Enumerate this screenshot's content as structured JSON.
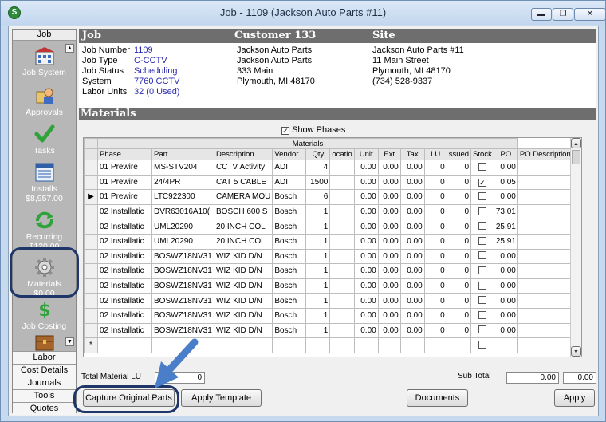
{
  "window": {
    "title": "Job - 1109 (Jackson Auto Parts #11)",
    "app_icon": "S",
    "controls": [
      "minimize",
      "restore",
      "close"
    ]
  },
  "sidebar": {
    "header": "Job",
    "items": [
      {
        "label": "Job System",
        "sub": "",
        "icon": "building-icon"
      },
      {
        "label": "Approvals",
        "sub": "",
        "icon": "approvals-icon"
      },
      {
        "label": "Tasks",
        "sub": "",
        "icon": "check-icon"
      },
      {
        "label": "Installs",
        "sub": "$8,957.00",
        "icon": "installs-icon"
      },
      {
        "label": "Recurring",
        "sub": "$120.00",
        "icon": "recurring-icon"
      },
      {
        "label": "Materials",
        "sub": "$0.00",
        "icon": "gear-icon"
      },
      {
        "label": "Job Costing",
        "sub": "",
        "icon": "dollar-icon"
      }
    ],
    "bottom": [
      "Labor",
      "Cost Details",
      "Journals",
      "Tools",
      "Quotes"
    ]
  },
  "headers": {
    "job": "Job",
    "customer": "Customer 133",
    "site": "Site"
  },
  "job": [
    {
      "label": "Job Number",
      "value": "1109"
    },
    {
      "label": "Job Type",
      "value": "C-CCTV"
    },
    {
      "label": "Job Status",
      "value": "Scheduling"
    },
    {
      "label": "System",
      "value": "7760 CCTV"
    },
    {
      "label": "Labor Units",
      "value": "32 (0 Used)"
    }
  ],
  "customer": [
    "Jackson Auto Parts",
    "Jackson Auto Parts",
    "333 Main",
    "Plymouth, MI  48170"
  ],
  "site": [
    "Jackson Auto Parts #11",
    "11 Main Street",
    "Plymouth, MI  48170",
    "(734) 528-9337"
  ],
  "materials_title": "Materials",
  "show_phases": {
    "label": "Show Phases",
    "checked": true
  },
  "grid": {
    "group_header": "Materials",
    "columns": [
      "Phase",
      "Part",
      "Description",
      "Vendor",
      "Qty",
      "ocatio",
      "Unit",
      "Ext",
      "Tax",
      "LU",
      "ssued",
      "Stock",
      "PO",
      "PO Description"
    ],
    "rows": [
      [
        "01 Prewire",
        "MS-STV204",
        "CCTV Activity",
        "ADI",
        "4",
        "",
        "0.00",
        "0.00",
        "0.00",
        "0",
        "0",
        "",
        "0.00",
        ""
      ],
      [
        "01 Prewire",
        "24/4PR",
        "CAT 5 CABLE",
        "ADI",
        "1500",
        "",
        "0.00",
        "0.00",
        "0.00",
        "0",
        "0",
        "checked",
        "0.05",
        ""
      ],
      [
        "01 Prewire",
        "LTC922300",
        "CAMERA MOU",
        "Bosch",
        "6",
        "",
        "0.00",
        "0.00",
        "0.00",
        "0",
        "0",
        "",
        "0.00",
        ""
      ],
      [
        "02 Installatic",
        "DVR63016A10(",
        "BOSCH 600 S",
        "Bosch",
        "1",
        "",
        "0.00",
        "0.00",
        "0.00",
        "0",
        "0",
        "",
        "73.01",
        ""
      ],
      [
        "02 Installatic",
        "UML20290",
        "20 INCH  COL",
        "Bosch",
        "1",
        "",
        "0.00",
        "0.00",
        "0.00",
        "0",
        "0",
        "",
        "25.91",
        ""
      ],
      [
        "02 Installatic",
        "UML20290",
        "20 INCH  COL",
        "Bosch",
        "1",
        "",
        "0.00",
        "0.00",
        "0.00",
        "0",
        "0",
        "",
        "25.91",
        ""
      ],
      [
        "02 Installatic",
        "BOSWZ18NV31",
        "WIZ KID D/N",
        "Bosch",
        "1",
        "",
        "0.00",
        "0.00",
        "0.00",
        "0",
        "0",
        "",
        "0.00",
        ""
      ],
      [
        "02 Installatic",
        "BOSWZ18NV31",
        "WIZ KID D/N",
        "Bosch",
        "1",
        "",
        "0.00",
        "0.00",
        "0.00",
        "0",
        "0",
        "",
        "0.00",
        ""
      ],
      [
        "02 Installatic",
        "BOSWZ18NV31",
        "WIZ KID D/N",
        "Bosch",
        "1",
        "",
        "0.00",
        "0.00",
        "0.00",
        "0",
        "0",
        "",
        "0.00",
        ""
      ],
      [
        "02 Installatic",
        "BOSWZ18NV31",
        "WIZ KID D/N",
        "Bosch",
        "1",
        "",
        "0.00",
        "0.00",
        "0.00",
        "0",
        "0",
        "",
        "0.00",
        ""
      ],
      [
        "02 Installatic",
        "BOSWZ18NV31",
        "WIZ KID D/N",
        "Bosch",
        "1",
        "",
        "0.00",
        "0.00",
        "0.00",
        "0",
        "0",
        "",
        "0.00",
        ""
      ],
      [
        "02 Installatic",
        "BOSWZ18NV31",
        "WIZ KID D/N",
        "Bosch",
        "1",
        "",
        "0.00",
        "0.00",
        "0.00",
        "0",
        "0",
        "",
        "0.00",
        ""
      ]
    ],
    "current_row": 2,
    "new_row_marker": "*"
  },
  "footer": {
    "total_material_lu_label": "Total Material LU",
    "total_material_lu_value": "0",
    "sub_total_label": "Sub Total",
    "sub_total_1": "0.00",
    "sub_total_2": "0.00"
  },
  "buttons": {
    "capture": "Capture Original Parts",
    "apply_template": "Apply Template",
    "documents": "Documents",
    "apply": "Apply"
  },
  "colors": {
    "header_bar": "#6e6e6e",
    "sidebar": "#b7b7b7",
    "value_text": "#2b2bb0",
    "highlight": "#1f3768",
    "arrow": "#4a7ec8"
  }
}
